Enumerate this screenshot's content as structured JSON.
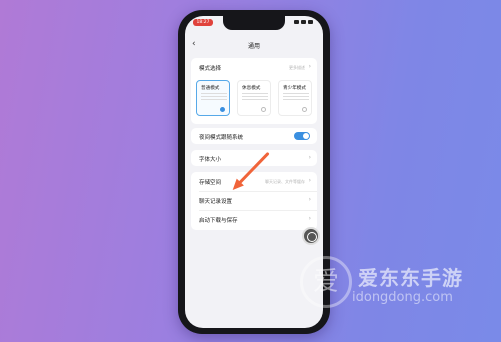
{
  "status_bar": {
    "time": "18:27"
  },
  "nav": {
    "back_icon": "chevron-left-icon",
    "title": "通用"
  },
  "mode_section": {
    "title": "模式选择",
    "hint": "更多描述",
    "modes": [
      {
        "name": "普通模式",
        "selected": true
      },
      {
        "name": "休息模式",
        "selected": false
      },
      {
        "name": "青少年模式",
        "selected": false
      }
    ]
  },
  "dark_toggle": {
    "label": "夜间模式跟随系统",
    "on": true
  },
  "font_row": {
    "label": "字体大小"
  },
  "storage_row": {
    "label": "存储空间",
    "hint": "聊天记录、文件等缓存"
  },
  "chat_row": {
    "label": "聊天记录设置"
  },
  "download_row": {
    "label": "启动下载与保存"
  },
  "watermark": {
    "logo": "爱",
    "cn": "爱东东手游",
    "en": "idongdong.com"
  },
  "colors": {
    "accent": "#3a8fe0",
    "arrow": "#f0643a"
  }
}
